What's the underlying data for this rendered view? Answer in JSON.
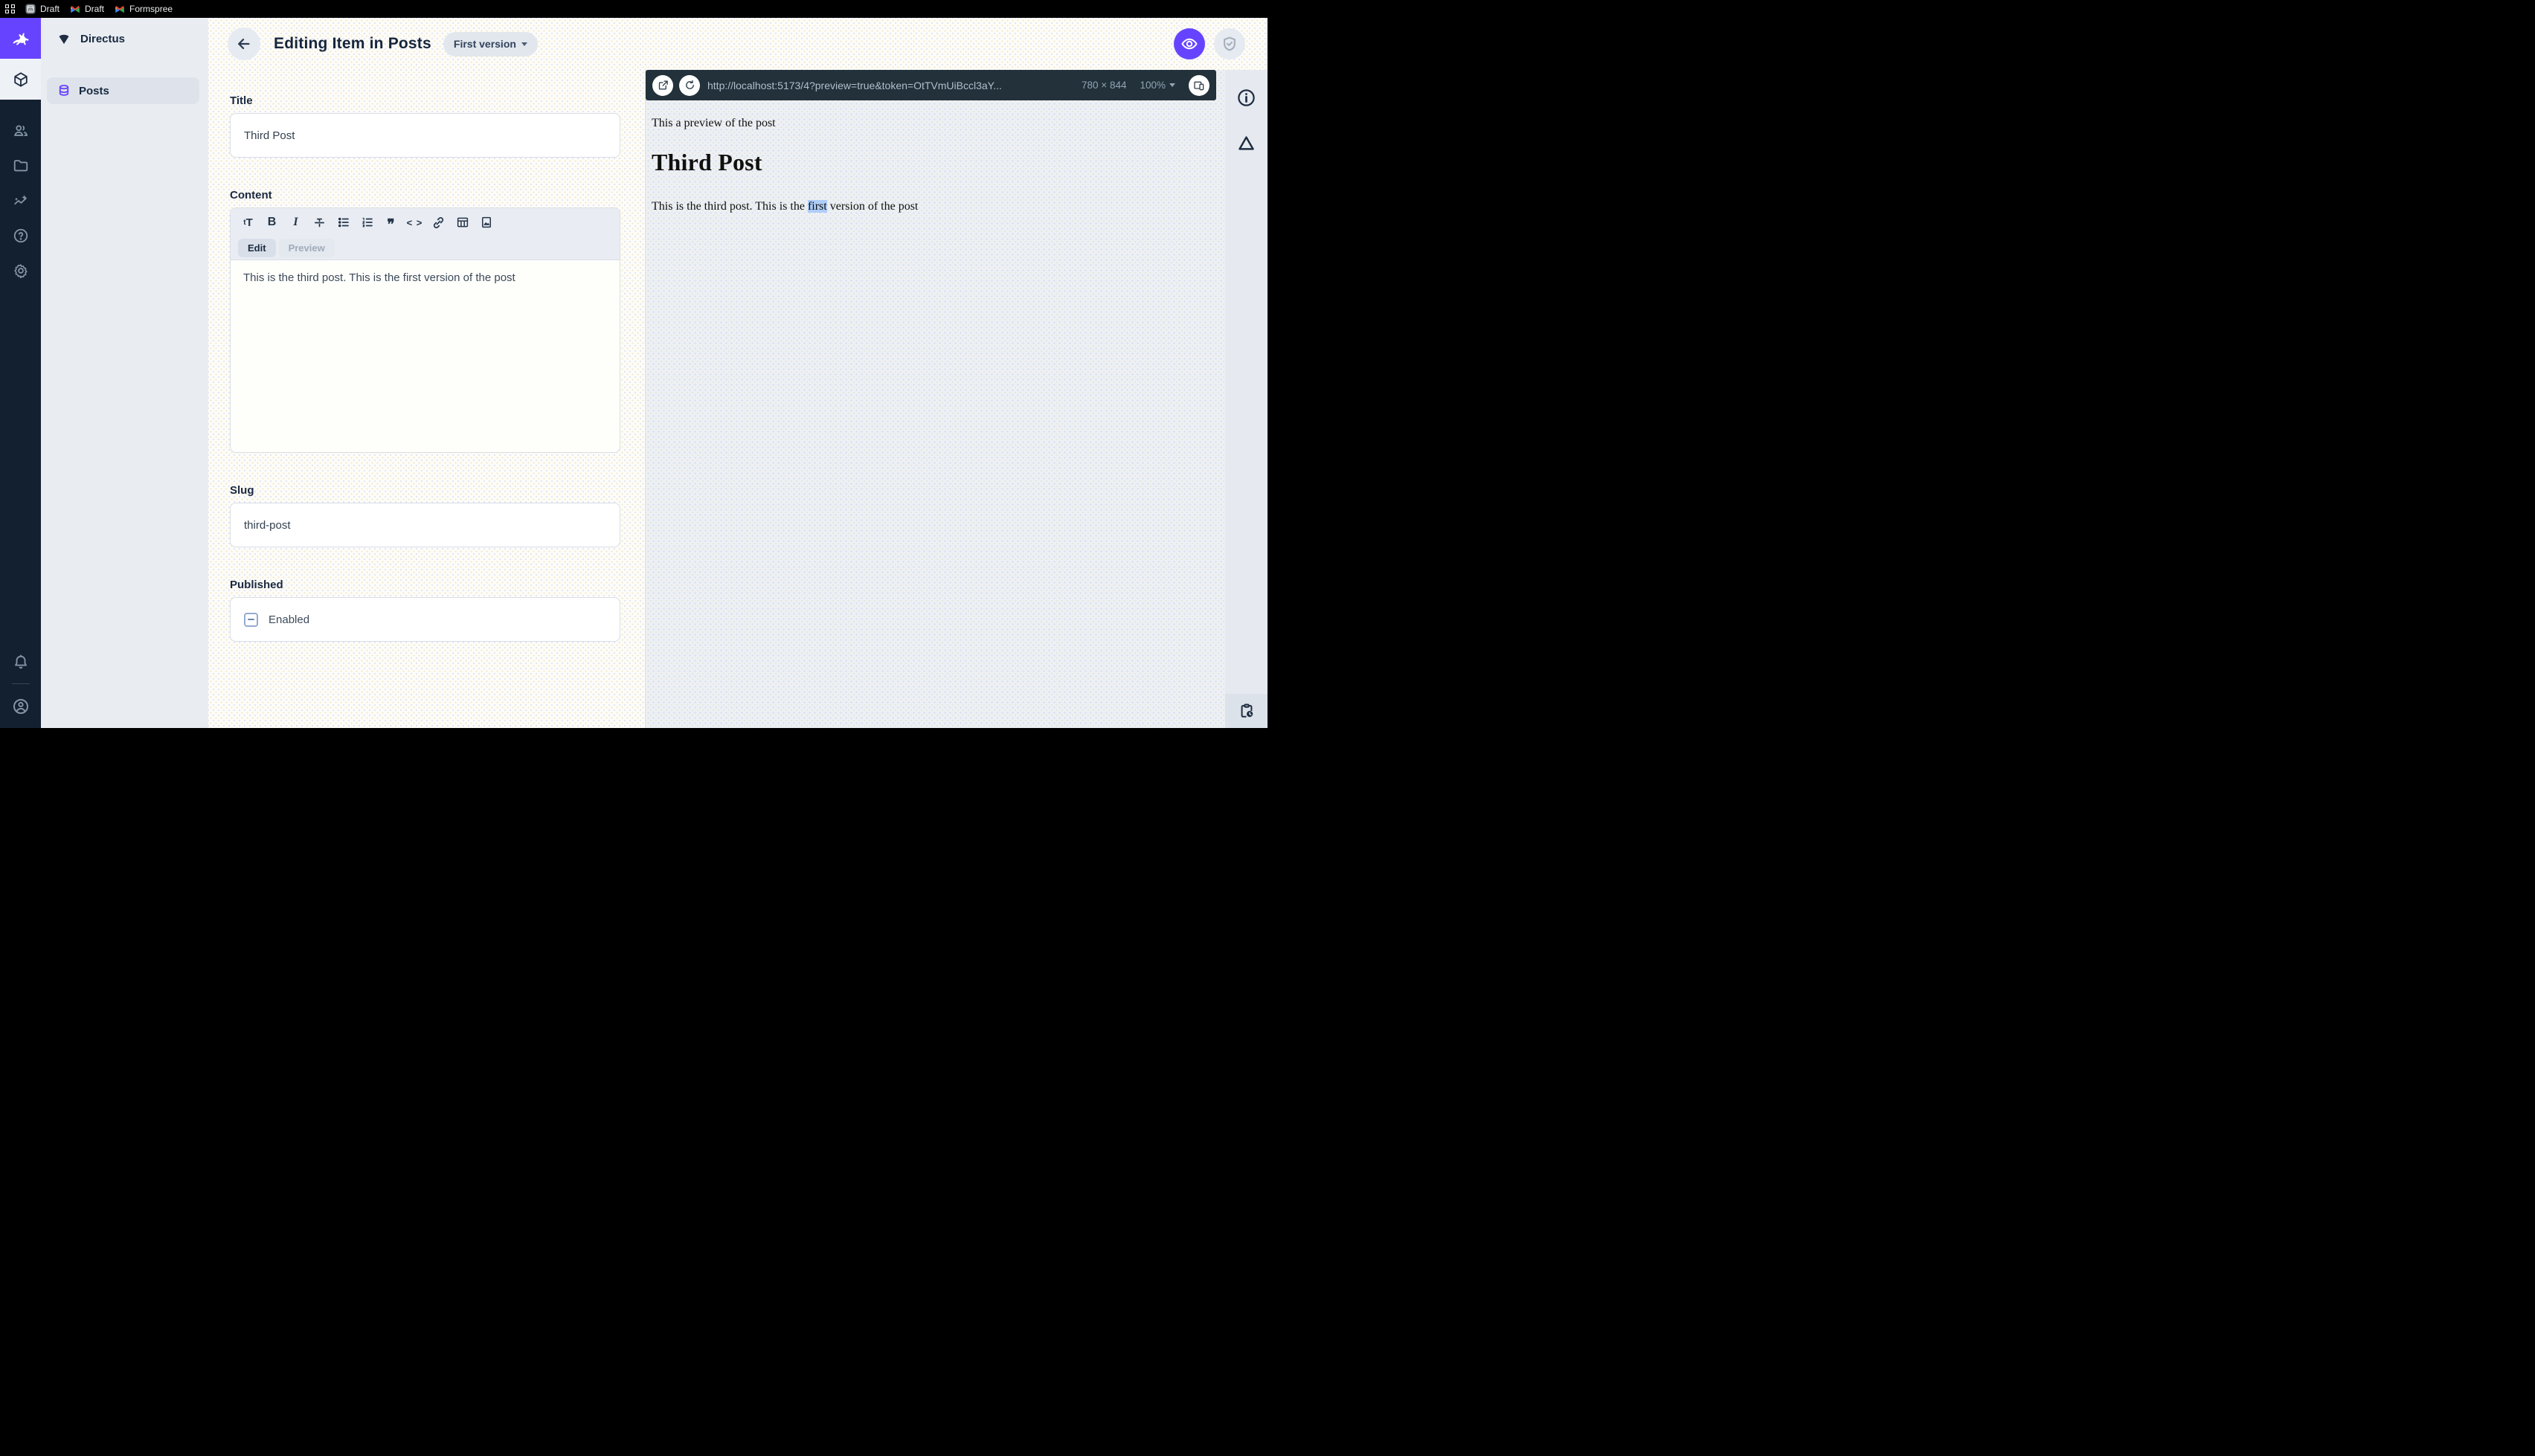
{
  "browser": {
    "tabs": [
      {
        "label": "Draft",
        "icon": "calendar-icon"
      },
      {
        "label": "Draft",
        "icon": "gmail-icon"
      },
      {
        "label": "Formspree",
        "icon": "gmail-icon"
      }
    ]
  },
  "nav": {
    "project_name": "Directus",
    "items": [
      {
        "label": "Posts"
      }
    ]
  },
  "header": {
    "title": "Editing Item in Posts",
    "version_label": "First version"
  },
  "form": {
    "title_field": {
      "label": "Title",
      "value": "Third Post"
    },
    "content_field": {
      "label": "Content",
      "tabs": {
        "edit": "Edit",
        "preview": "Preview"
      },
      "value": "This is the third post. This is the first version of the post",
      "toolbar_glyphs": {
        "format_size_small": "t",
        "format_size_big": "T",
        "bold": "B",
        "italic": "I",
        "quote": "❞",
        "code": "< >"
      }
    },
    "slug_field": {
      "label": "Slug",
      "value": "third-post"
    },
    "published_field": {
      "label": "Published",
      "checkbox_label": "Enabled"
    }
  },
  "preview": {
    "url": "http://localhost:5173/4?preview=true&token=OtTVmUiBccl3aY...",
    "dimensions": "780 × 844",
    "zoom": "100%",
    "page": {
      "intro": "This a preview of the post",
      "heading": "Third Post",
      "body_before": "This is the third post. This is the ",
      "body_highlight": "first",
      "body_after": " version of the post"
    }
  },
  "colors": {
    "accent": "#6644ff",
    "module_bar": "#13202f",
    "url_bar": "#22313a",
    "highlight": "#aecdf9"
  }
}
